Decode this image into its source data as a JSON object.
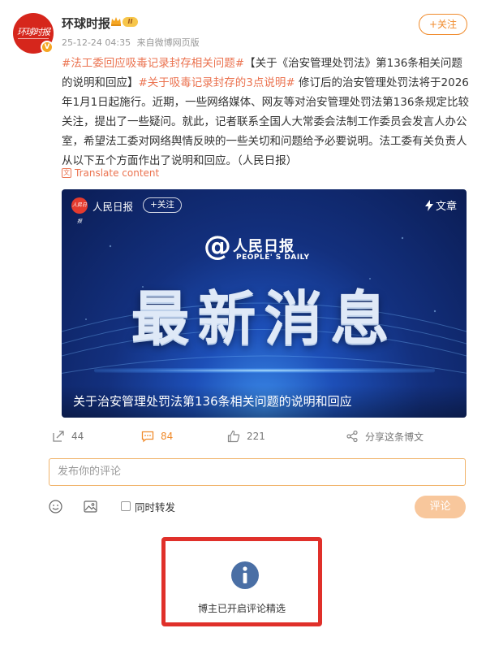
{
  "header": {
    "name": "环球时报",
    "level_badge": "II",
    "timestamp": "25-12-24 04:35",
    "source_prefix": "来自",
    "source": "微博网页版",
    "follow_label": "+关注",
    "avatar_text": "环球时报"
  },
  "post": {
    "topic_1": "#法工委回应吸毒记录封存相关问题#",
    "text_1": "【关于《治安管理处罚法》第136条相关问题的说明和回应】",
    "topic_2": "#关于吸毒记录封存的3点说明#",
    "text_2": " 修订后的治安管理处罚法将于2026年1月1日起施行。近期，一些网络媒体、网友等对治安管理处罚法第136条规定比较关注，提出了一些疑问。就此，记者联系全国人大常委会法制工作委员会发言人办公室，希望法工委对网络舆情反映的一些关切和问题给予必要说明。法工委有关负责人从以下五个方面作出了说明和回应。（人民日报）",
    "translate_label": "Translate content"
  },
  "card": {
    "source_name": "人民日报",
    "follow_label": "+关注",
    "type_label": "文章",
    "brand_at": "@",
    "brand_cn": "人民日报",
    "brand_en": "PEOPLE' S DAILY",
    "big_title": "最新消息",
    "caption": "关于治安管理处罚法第136条相关问题的说明和回应",
    "avatar_text": "人民日报"
  },
  "actions": {
    "forward_count": "44",
    "comment_count": "84",
    "like_count": "221",
    "share_label": "分享这条博文"
  },
  "comment": {
    "placeholder": "发布你的评论",
    "repost_label": "同时转发",
    "submit_label": "评论"
  },
  "notice": {
    "text": "博主已开启评论精选"
  },
  "colors": {
    "accent": "#eb7350",
    "follow": "#f08b2c",
    "highlight_border": "#e0302a",
    "info_icon": "#4a6fa5"
  }
}
